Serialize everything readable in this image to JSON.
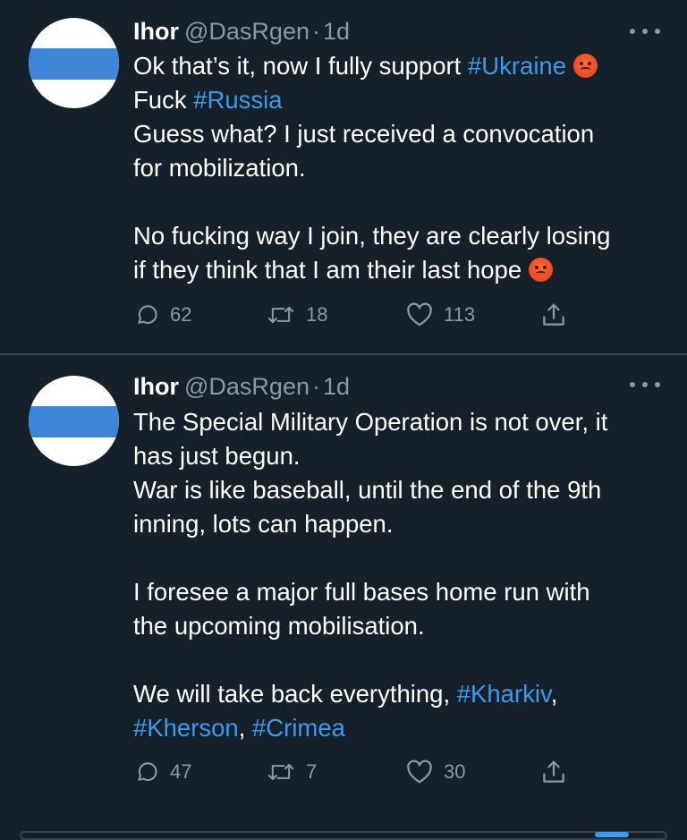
{
  "colors": {
    "background": "#15202b",
    "text": "#ffffff",
    "secondary": "#8b98a5",
    "link": "#3c9ae8",
    "divider": "#38444d",
    "avatar_stripe": "#3d86d8"
  },
  "tweets": [
    {
      "name": "Ihor",
      "handle": "@DasRgen",
      "separator": "·",
      "time": "1d",
      "lines": {
        "l1_text": "Ok that’s it, now I fully support ",
        "l1_tag": "#Ukraine",
        "l2_text": "Fuck ",
        "l2_tag": "#Russia",
        "l3": "Guess what? I just received a convocation",
        "l4": "for mobilization.",
        "l5": "No fucking way I join, they are clearly losing",
        "l6": "if they think that I am their last hope"
      },
      "replies": "62",
      "retweets": "18",
      "likes": "113",
      "icons": [
        "more-icon",
        "angry-face-emoji",
        "reply-icon",
        "retweet-icon",
        "heart-icon",
        "share-icon"
      ]
    },
    {
      "name": "Ihor",
      "handle": "@DasRgen",
      "separator": "·",
      "time": "1d",
      "lines": {
        "l1": "The Special Military Operation is not over, it",
        "l2": "has just begun.",
        "l3": "War is like baseball, until the end of the 9th",
        "l4": "inning, lots can happen.",
        "l5": "I foresee a major full bases home run with",
        "l6": "the upcoming mobilisation.",
        "l7_text": "We will take back everything, ",
        "l7_tag": "#Kharkiv",
        "l7_end": ",",
        "l8_tag1": "#Kherson",
        "l8_mid": ", ",
        "l8_tag2": "#Crimea"
      },
      "replies": "47",
      "retweets": "7",
      "likes": "30",
      "icons": [
        "more-icon",
        "reply-icon",
        "retweet-icon",
        "heart-icon",
        "share-icon"
      ]
    }
  ]
}
